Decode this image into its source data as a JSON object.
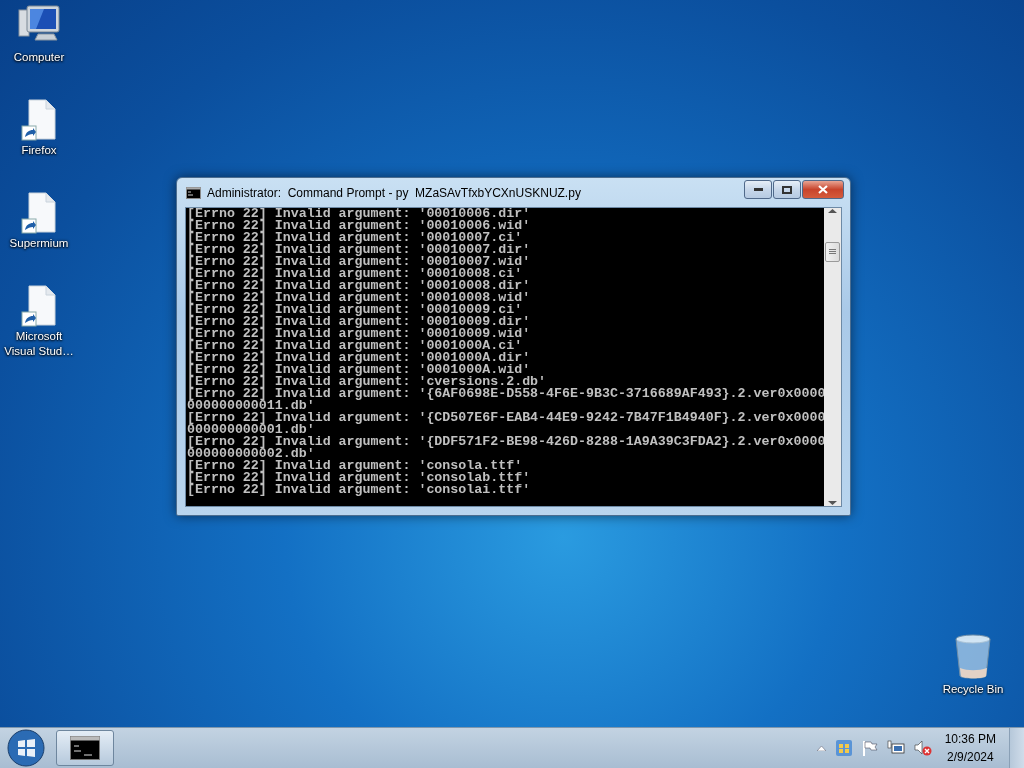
{
  "desktop_icons": [
    {
      "label": "Computer",
      "kind": "computer"
    },
    {
      "label": "Firefox",
      "kind": "shortcut"
    },
    {
      "label": "Supermium",
      "kind": "shortcut"
    },
    {
      "label": "Microsoft Visual Stud…",
      "kind": "shortcut"
    }
  ],
  "recycle_bin": {
    "label": "Recycle Bin"
  },
  "window": {
    "title": "Administrator:  Command Prompt - py  MZaSAvTfxbYCXnUSKNUZ.py",
    "lines": [
      "[Errno 22] Invalid argument: '00010006.dir'",
      "[Errno 22] Invalid argument: '00010006.wid'",
      "[Errno 22] Invalid argument: '00010007.ci'",
      "[Errno 22] Invalid argument: '00010007.dir'",
      "[Errno 22] Invalid argument: '00010007.wid'",
      "[Errno 22] Invalid argument: '00010008.ci'",
      "[Errno 22] Invalid argument: '00010008.dir'",
      "[Errno 22] Invalid argument: '00010008.wid'",
      "[Errno 22] Invalid argument: '00010009.ci'",
      "[Errno 22] Invalid argument: '00010009.dir'",
      "[Errno 22] Invalid argument: '00010009.wid'",
      "[Errno 22] Invalid argument: '0001000A.ci'",
      "[Errno 22] Invalid argument: '0001000A.dir'",
      "[Errno 22] Invalid argument: '0001000A.wid'",
      "[Errno 22] Invalid argument: 'cversions.2.db'",
      "[Errno 22] Invalid argument: '{6AF0698E-D558-4F6E-9B3C-3716689AF493}.2.ver0x0000",
      "000000000011.db'",
      "[Errno 22] Invalid argument: '{CD507E6F-EAB4-44E9-9242-7B47F1B4940F}.2.ver0x0000",
      "000000000001.db'",
      "[Errno 22] Invalid argument: '{DDF571F2-BE98-426D-8288-1A9A39C3FDA2}.2.ver0x0000",
      "000000000002.db'",
      "[Errno 22] Invalid argument: 'consola.ttf'",
      "[Errno 22] Invalid argument: 'consolab.ttf'",
      "[Errno 22] Invalid argument: 'consolai.ttf'"
    ]
  },
  "taskbar": {
    "time": "10:36 PM",
    "date": "2/9/2024"
  }
}
